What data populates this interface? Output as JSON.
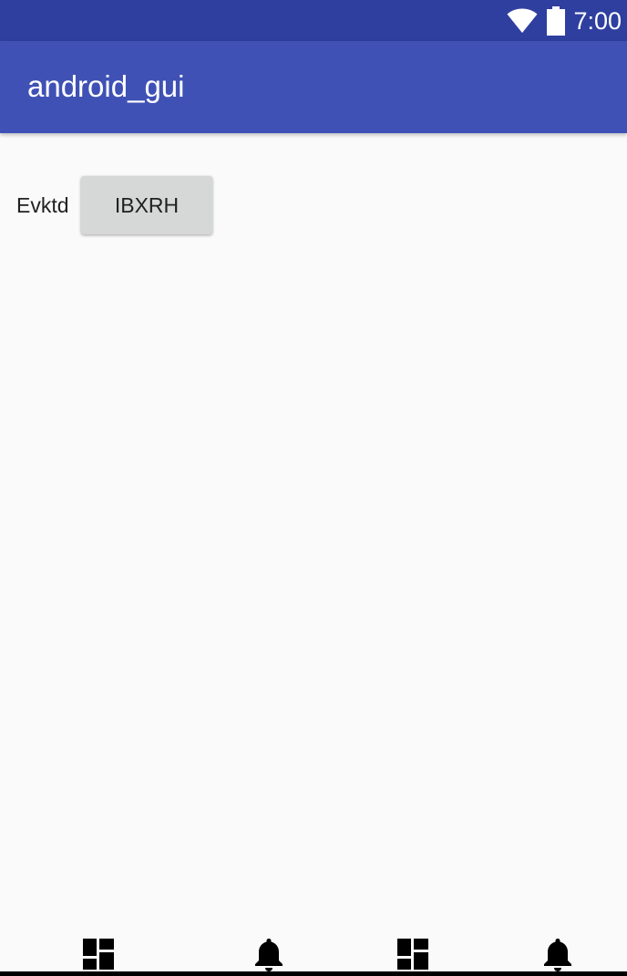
{
  "status_bar": {
    "time": "7:00",
    "icons": [
      "wifi-icon",
      "battery-icon"
    ]
  },
  "app_bar": {
    "title": "android_gui"
  },
  "main": {
    "label": "Evktd",
    "button_label": "IBXRH"
  },
  "bottom_nav": {
    "items": [
      {
        "icon": "dashboard-icon"
      },
      {
        "icon": "notifications-icon"
      },
      {
        "icon": "dashboard-icon"
      },
      {
        "icon": "notifications-icon"
      }
    ]
  },
  "colors": {
    "status_bar": "#2f3f9f",
    "app_bar": "#3f51b5",
    "background": "#fafafa",
    "button": "#d6d7d7"
  }
}
